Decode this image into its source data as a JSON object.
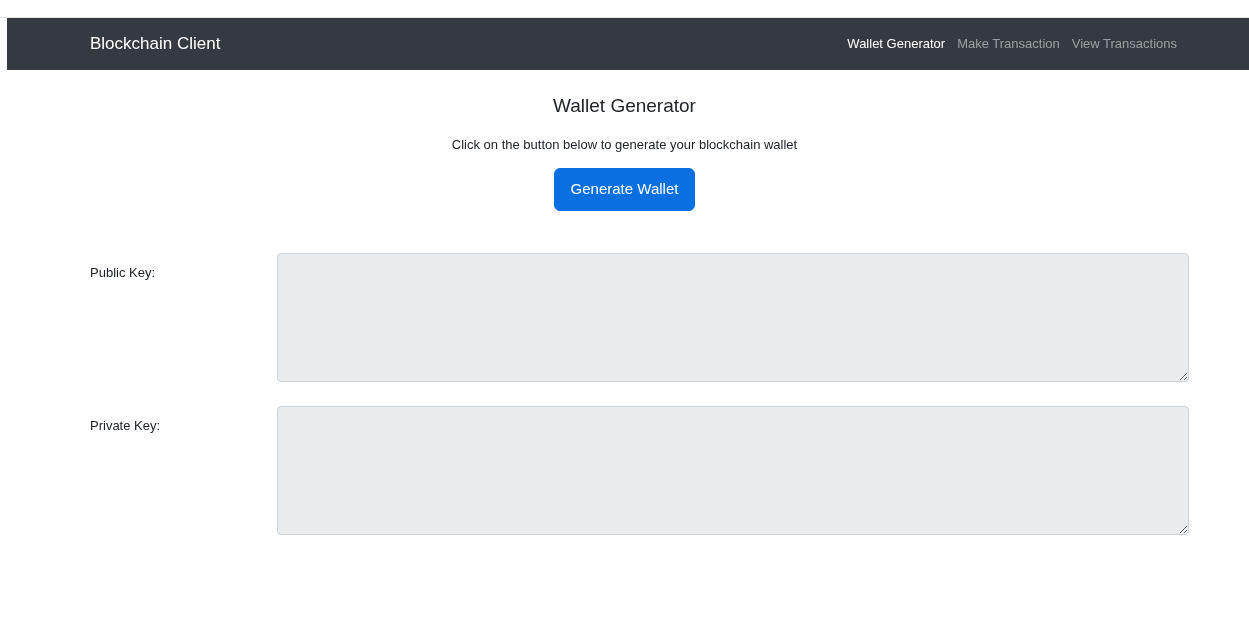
{
  "navbar": {
    "brand": "Blockchain Client",
    "links": [
      {
        "label": "Wallet Generator",
        "selected": true
      },
      {
        "label": "Make Transaction",
        "selected": false
      },
      {
        "label": "View Transactions",
        "selected": false
      }
    ]
  },
  "heading": "Wallet Generator",
  "instruction": "Click on the button below to generate your blockchain wallet",
  "button": "Generate Wallet",
  "fields": [
    {
      "label": "Public Key:",
      "disabled": true
    },
    {
      "label": "Private Key:",
      "disabled": true
    }
  ]
}
